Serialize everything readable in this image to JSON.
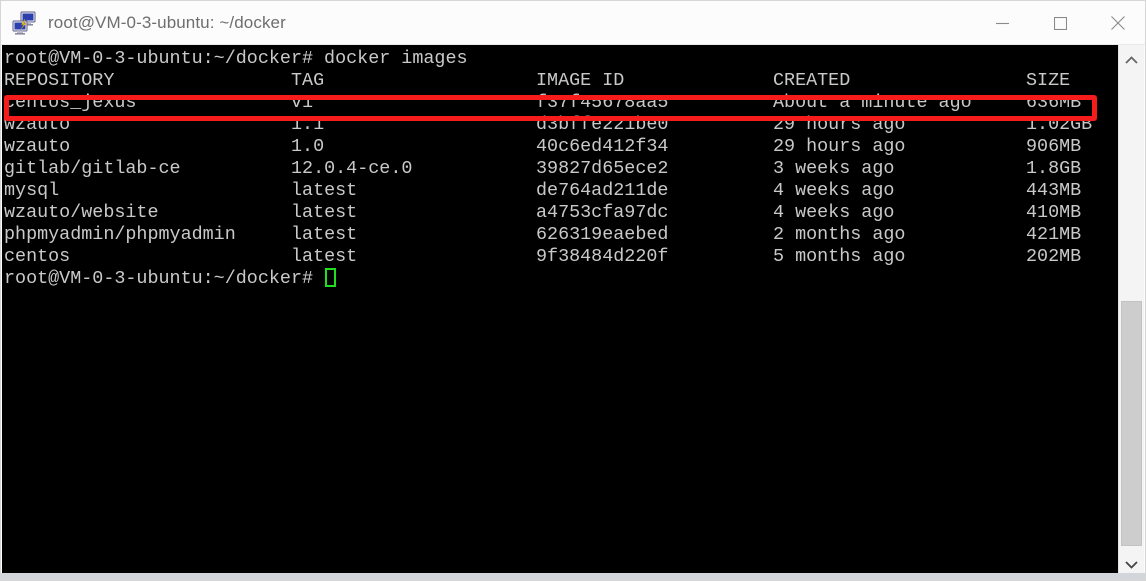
{
  "window": {
    "title": "root@VM-0-3-ubuntu: ~/docker",
    "icon": "putty-terminal-icon",
    "controls": {
      "minimize": "minimize-icon",
      "maximize": "maximize-icon",
      "close": "close-icon"
    }
  },
  "terminal": {
    "background_color": "#000000",
    "text_color": "#c9c9c9",
    "cursor_color": "#1ee01e",
    "prompt": "root@VM-0-3-ubuntu:~/docker# ",
    "command": "docker images",
    "command_line": "root@VM-0-3-ubuntu:~/docker# docker images",
    "final_prompt": "root@VM-0-3-ubuntu:~/docker# ",
    "headers": {
      "repository": "REPOSITORY",
      "tag": "TAG",
      "image_id": "IMAGE ID",
      "created": "CREATED",
      "size": "SIZE"
    },
    "rows": [
      {
        "repository": "centos_jexus",
        "tag": "v1",
        "image_id": "f37f45678aa5",
        "created": "About a minute ago",
        "size": "636MB",
        "highlighted": true
      },
      {
        "repository": "wzauto",
        "tag": "1.1",
        "image_id": "d3bffe221be0",
        "created": "29 hours ago",
        "size": "1.02GB",
        "highlighted": false
      },
      {
        "repository": "wzauto",
        "tag": "1.0",
        "image_id": "40c6ed412f34",
        "created": "29 hours ago",
        "size": "906MB",
        "highlighted": false
      },
      {
        "repository": "gitlab/gitlab-ce",
        "tag": "12.0.4-ce.0",
        "image_id": "39827d65ece2",
        "created": "3 weeks ago",
        "size": "1.8GB",
        "highlighted": false
      },
      {
        "repository": "mysql",
        "tag": "latest",
        "image_id": "de764ad211de",
        "created": "4 weeks ago",
        "size": "443MB",
        "highlighted": false
      },
      {
        "repository": "wzauto/website",
        "tag": "latest",
        "image_id": "a4753cfa97dc",
        "created": "4 weeks ago",
        "size": "410MB",
        "highlighted": false
      },
      {
        "repository": "phpmyadmin/phpmyadmin",
        "tag": "latest",
        "image_id": "626319eaebed",
        "created": "2 months ago",
        "size": "421MB",
        "highlighted": false
      },
      {
        "repository": "centos",
        "tag": "latest",
        "image_id": "9f38484d220f",
        "created": "5 months ago",
        "size": "202MB",
        "highlighted": false
      }
    ]
  },
  "annotation": {
    "color": "#f71c1c",
    "target_row": "centos_jexus"
  },
  "scrollbar": {
    "up_arrow": "chevron-up-icon",
    "down_arrow": "chevron-down-icon"
  }
}
